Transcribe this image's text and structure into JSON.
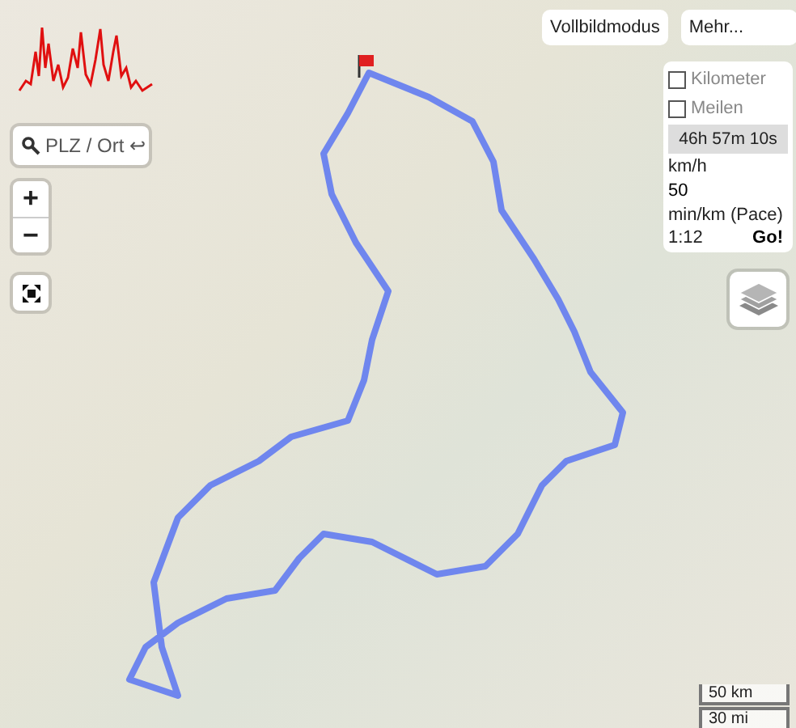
{
  "search": {
    "placeholder": "PLZ / Ort ↩"
  },
  "zoom": {
    "in": "+",
    "out": "−"
  },
  "top_buttons": [
    "Vollbildmodus",
    "Mehr..."
  ],
  "units": [
    {
      "label": "Kilometer",
      "checked": false
    },
    {
      "label": "Meilen",
      "checked": false
    }
  ],
  "duration": "46h 57m 10s",
  "speed": {
    "label": "km/h",
    "value": "50"
  },
  "pace": {
    "label": "min/km (Pace)",
    "value": "1:12"
  },
  "go_button": "Go!",
  "scale": [
    "50 km",
    "30 mi"
  ]
}
